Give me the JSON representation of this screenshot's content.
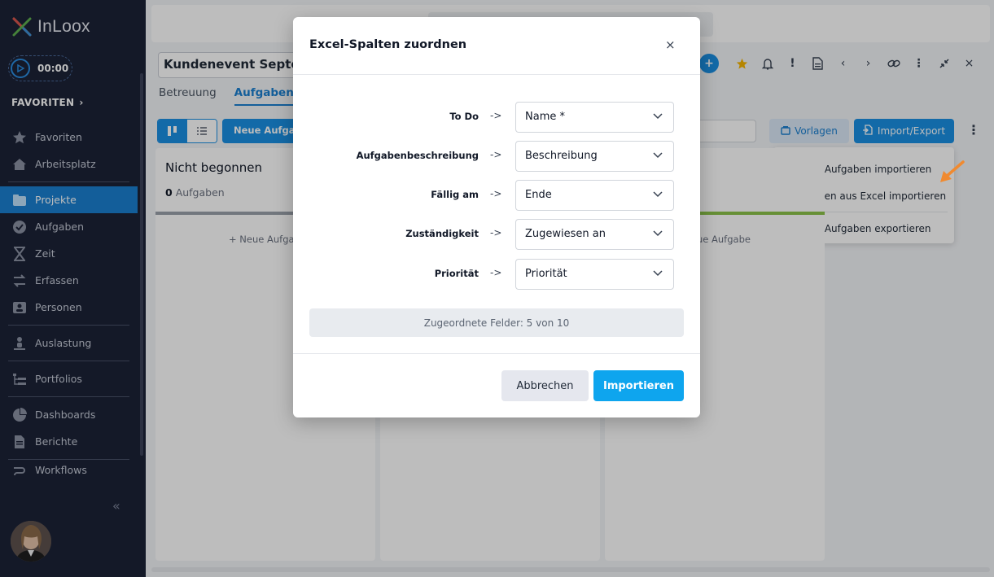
{
  "app": {
    "logo_text": "InLoox"
  },
  "sidebar": {
    "timer": "00:00",
    "favorites_header": "FAVORITEN",
    "items": [
      {
        "label": "Favoriten",
        "icon": "star-icon"
      },
      {
        "label": "Arbeitsplatz",
        "icon": "home-icon"
      },
      {
        "label": "Projekte",
        "icon": "folder-icon",
        "active": true
      },
      {
        "label": "Aufgaben",
        "icon": "check-circle-icon"
      },
      {
        "label": "Zeit",
        "icon": "hourglass-icon"
      },
      {
        "label": "Erfassen",
        "icon": "swap-icon"
      },
      {
        "label": "Personen",
        "icon": "contact-card-icon"
      },
      {
        "label": "Auslastung",
        "icon": "person-load-icon"
      },
      {
        "label": "Portfolios",
        "icon": "portfolio-tree-icon"
      },
      {
        "label": "Dashboards",
        "icon": "pie-chart-icon"
      },
      {
        "label": "Berichte",
        "icon": "report-icon"
      },
      {
        "label": "Workflows",
        "icon": "workflow-icon"
      }
    ]
  },
  "project": {
    "title": "Kundenevent Septem",
    "tabs": [
      "Betreuung",
      "Aufgaben"
    ],
    "new_task_button": "Neue Aufgabe",
    "vorlagen_button": "Vorlagen",
    "import_export_button": "Import/Export"
  },
  "import_menu": {
    "items": [
      "InLoox Aufgaben importieren",
      "Aufgaben aus Excel importieren",
      "InLoox Aufgaben exportieren"
    ]
  },
  "board": {
    "columns": [
      {
        "title": "Nicht begonnen",
        "count": "0",
        "count_label": "Aufgaben",
        "new_label": "Neue Aufgab",
        "bar_color": "#9aa1ab"
      },
      {
        "title": "",
        "count": "",
        "count_label": "",
        "new_label": "",
        "bar_color": "#9aa1ab"
      },
      {
        "title": "",
        "count": "",
        "count_label": "",
        "new_label": "ue Aufgabe",
        "bar_color": "#8bc34a"
      }
    ]
  },
  "modal": {
    "title": "Excel-Spalten zuordnen",
    "close_symbol": "×",
    "arrow_symbol": "->",
    "mappings": [
      {
        "label": "To Do",
        "value": "Name *"
      },
      {
        "label": "Aufgabenbeschreibung",
        "value": "Beschreibung"
      },
      {
        "label": "Fällig am",
        "value": "Ende"
      },
      {
        "label": "Zuständigkeit",
        "value": "Zugewiesen an"
      },
      {
        "label": "Priorität",
        "value": "Priorität"
      }
    ],
    "summary": "Zugeordnete Felder: 5 von 10",
    "cancel_button": "Abbrechen",
    "import_button": "Importieren"
  },
  "colors": {
    "sidebar_bg": "#1b2236",
    "accent": "#1a8fe3",
    "import_button": "#0ea5ee",
    "annotation_arrow": "#f08a30"
  }
}
